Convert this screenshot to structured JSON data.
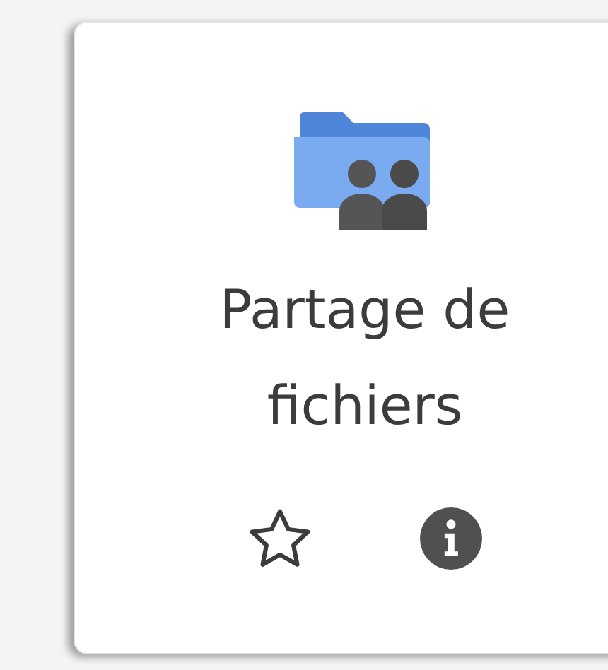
{
  "tile": {
    "title": "Partage de fichiers",
    "favorite": false
  }
}
